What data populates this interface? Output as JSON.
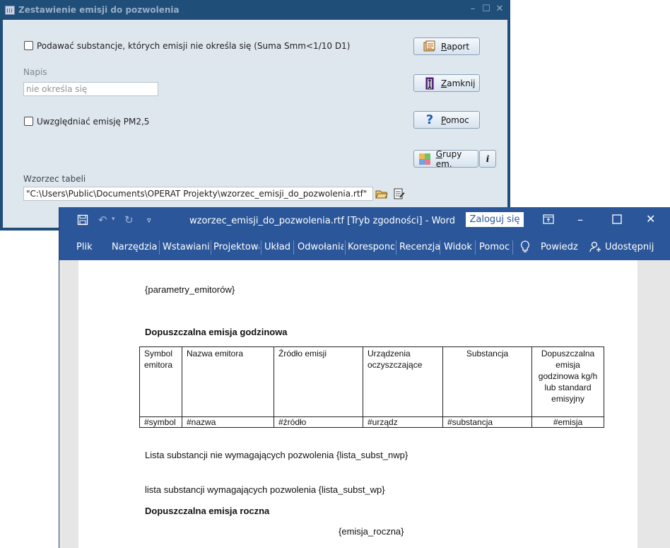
{
  "dialog": {
    "title": "Zestawienie  emisji do pozwolenia",
    "checkbox_substances_label": "Podawać substancje, których emisji nie określa się (Suma Smm<1/10 D1)",
    "napis_label": "Napis",
    "napis_value": "nie określa się",
    "checkbox_pm25_label": "Uwzględniać emisję PM2,5",
    "template_label": "Wzorzec tabeli",
    "template_path": "\"C:\\Users\\Public\\Documents\\OPERAT Projekty\\wzorzec_emisji_do_pozwolenia.rtf\"",
    "buttons": {
      "raport": "Raport",
      "zamknij": "Zamknij",
      "pomoc": "Pomoc",
      "grupy": "Grupy em.",
      "info": "i"
    }
  },
  "word": {
    "title": "wzorzec_emisji_do_pozwolenia.rtf [Tryb zgodności]  -  Word",
    "login_label": "Zaloguj się",
    "tabs": [
      "Plik",
      "Narzędzia",
      "Wstawianie",
      "Projektowanie",
      "Układ",
      "Odwołania",
      "Korespondencja",
      "Recenzja",
      "Widok",
      "Pomoc"
    ],
    "tell_me": "Powiedz",
    "share": "Udostępnij",
    "doc": {
      "param_line": "{parametry_emitorów}",
      "heading_hourly": "Dopuszczalna  emisja godzinowa",
      "table_headers": [
        "Symbol emitora",
        "Nazwa emitora",
        "Źródło emisji",
        "Urządzenia oczyszczające",
        "Substancja",
        "Dopuszczalna emisja godzinowa kg/h lub standard emisyjny"
      ],
      "table_row": [
        "#symbol",
        "#nazwa",
        "#źródło",
        "#urządz",
        "#substancja",
        "#emisja"
      ],
      "list_nwp": "Lista substancji nie wymagających pozwolenia {lista_subst_nwp}",
      "list_wp": "lista substancji wymagających pozwolenia  {lista_subst_wp}",
      "heading_annual": "Dopuszczalna emisja roczna",
      "annual_placeholder": "{emisja_roczna}"
    }
  }
}
